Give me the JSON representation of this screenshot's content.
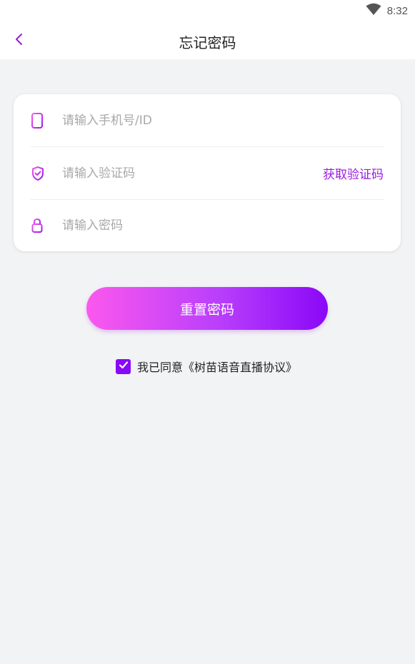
{
  "status_bar": {
    "time": "8:32",
    "wifi_icon": "wifi-icon"
  },
  "header": {
    "back_icon": "chevron-left-icon",
    "title": "忘记密码"
  },
  "form": {
    "phone": {
      "icon": "phone-icon",
      "placeholder": "请输入手机号/ID",
      "value": ""
    },
    "code": {
      "icon": "shield-check-icon",
      "placeholder": "请输入验证码",
      "value": "",
      "get_code_label": "获取验证码"
    },
    "password": {
      "icon": "lock-icon",
      "placeholder": "请输入密码",
      "value": ""
    }
  },
  "reset_button": {
    "label": "重置密码"
  },
  "agreement": {
    "checked": true,
    "text": "我已同意《树苗语音直播协议》"
  },
  "colors": {
    "accent": "#9a1be0",
    "gradient_start": "#fb58ee",
    "gradient_end": "#8a08f8",
    "background": "#f2f3f5"
  }
}
